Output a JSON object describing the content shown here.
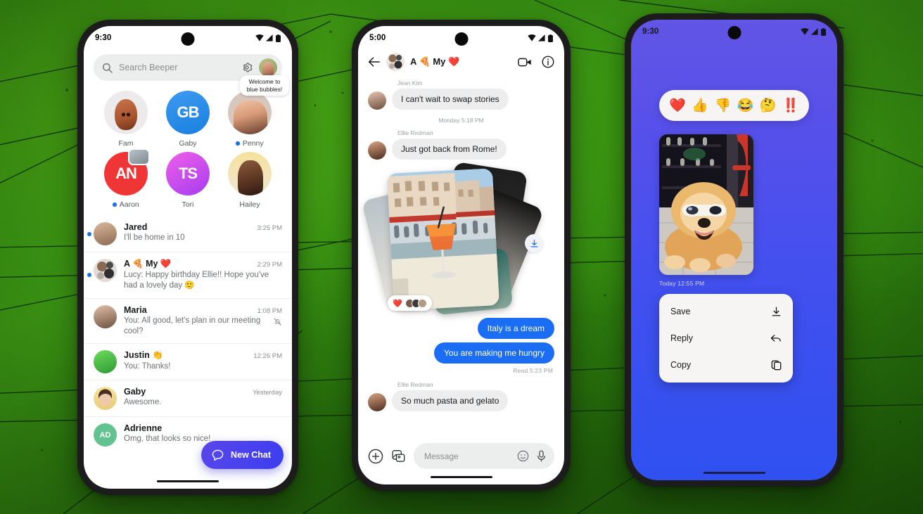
{
  "background": {
    "primary_color": "#2f8a0f",
    "accent_dark": "#1e5e08"
  },
  "phones": {
    "left": {
      "status": {
        "time": "9:30"
      },
      "search": {
        "placeholder": "Search Beeper",
        "icon": "search-icon",
        "settings_icon": "gear-icon",
        "avatar": "profile-avatar"
      },
      "pinned": [
        {
          "label": "Fam",
          "unread": false,
          "art": "dog-photo"
        },
        {
          "label": "Gaby",
          "unread": false,
          "art": "logo-gb",
          "logo_text": "GB",
          "color": "#2a8ef0"
        },
        {
          "label": "Penny",
          "unread": true,
          "art": "woman-photo",
          "bubble": "Welcome to blue bubbles!"
        },
        {
          "label": "Aaron",
          "unread": true,
          "art": "logo-an",
          "logo_text": "AN",
          "color": "#ef3535",
          "badge": "photo-badge"
        },
        {
          "label": "Tori",
          "unread": false,
          "art": "logo-ts",
          "logo_text": "TS",
          "color": "#d44df0"
        },
        {
          "label": "Hailey",
          "unread": false,
          "art": "woman-photo-2"
        }
      ],
      "chats": [
        {
          "name": "Jared",
          "time": "3:25 PM",
          "message": "I'll be home in 10",
          "unread": true,
          "muted": false,
          "avatar_color": "#6a6f74"
        },
        {
          "name": "A 🍕 My ❤️",
          "time": "2:29 PM",
          "message": "Lucy: Happy birthday Ellie!! Hope you've had a lovely day  🙂",
          "unread": true,
          "muted": false,
          "avatar_color": "#d8cfc9"
        },
        {
          "name": "Maria",
          "time": "1:08 PM",
          "message": "You: All good, let's plan in our meeting cool?",
          "unread": false,
          "muted": true,
          "avatar_color": "#9a8a80"
        },
        {
          "name": "Justin 👏",
          "time": "12:26 PM",
          "message": "You: Thanks!",
          "unread": false,
          "muted": false,
          "avatar_color": "#4caf50"
        },
        {
          "name": "Gaby",
          "time": "Yesterday",
          "message": "Awesome.",
          "unread": false,
          "muted": false,
          "avatar_color": "#f3e08a"
        },
        {
          "name": "Adrienne",
          "time": "",
          "message": "Omg, that looks so nice!",
          "unread": false,
          "muted": false,
          "avatar_color": "#5fc08a",
          "initials": "AD"
        }
      ],
      "fab": {
        "label": "New Chat",
        "icon": "chat-bubble-icon",
        "color": "#4a42ee"
      }
    },
    "middle": {
      "status": {
        "time": "5:00"
      },
      "header": {
        "back_icon": "back-arrow-icon",
        "title": "A 🍕 My ❤️",
        "video_icon": "video-camera-icon",
        "info_icon": "info-icon"
      },
      "messages": [
        {
          "type": "incoming",
          "sender": "Jean Kim",
          "text": "I can't wait to swap stories"
        },
        {
          "type": "separator",
          "text": "Monday 5:18 PM"
        },
        {
          "type": "incoming",
          "sender": "Ellie Redman",
          "text": "Just got back from Rome!"
        },
        {
          "type": "photos",
          "reaction": "❤️",
          "download_icon": "download-icon"
        },
        {
          "type": "outgoing",
          "text": "Italy is a dream"
        },
        {
          "type": "outgoing",
          "text": "You are making me hungry"
        },
        {
          "type": "receipt",
          "text": "Read  5:23 PM"
        },
        {
          "type": "incoming",
          "sender": "Ellie Redman",
          "text": "So much pasta and gelato"
        }
      ],
      "composer": {
        "plus_icon": "plus-circle-icon",
        "gallery_icon": "gallery-icon",
        "placeholder": "Message",
        "emoji_icon": "emoji-smiley-icon",
        "mic_icon": "microphone-icon"
      },
      "bubble_out_color": "#1b6ef3",
      "bubble_in_color": "#ededee"
    },
    "right": {
      "status": {
        "time": "9:30"
      },
      "reactions": [
        "❤️",
        "👍",
        "👎",
        "😂",
        "🤔",
        "‼️"
      ],
      "photo": {
        "alt": "dog-with-sunglasses"
      },
      "timestamp": "Today  12:55 PM",
      "menu": [
        {
          "label": "Save",
          "icon": "download-icon"
        },
        {
          "label": "Reply",
          "icon": "reply-arrow-icon"
        },
        {
          "label": "Copy",
          "icon": "copy-icon"
        }
      ],
      "bg_top": "#6155e5",
      "bg_bottom": "#2f51f0"
    }
  }
}
